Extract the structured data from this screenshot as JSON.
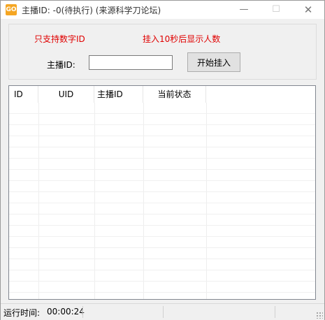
{
  "window": {
    "title": "主播ID: -0(待执行) (来源科学刀论坛)",
    "icon_text": "GO",
    "minimize_glyph": "—",
    "maximize_glyph": "☐",
    "close_glyph": "✕"
  },
  "form": {
    "notice_numeric": "只支持数字ID",
    "notice_delay": "挂入10秒后显示人数",
    "anchor_id_label": "主播ID:",
    "anchor_id_value": "",
    "start_button": "开始挂入"
  },
  "table": {
    "columns": [
      "ID",
      "UID",
      "主播ID",
      "当前状态"
    ],
    "rows": []
  },
  "status": {
    "runtime_label": "运行时间:",
    "runtime_value": "00:00:24"
  },
  "colors": {
    "notice": "#e00000",
    "window_bg": "#f0f0f0",
    "list_bg": "#ffffff"
  }
}
